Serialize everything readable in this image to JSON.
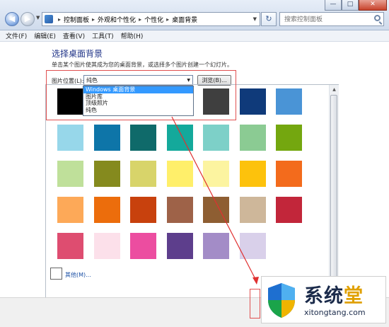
{
  "window": {
    "minimize": "—",
    "maximize": "□",
    "close": "✕"
  },
  "address_bar": {
    "breadcrumbs": [
      "控制面板",
      "外观和个性化",
      "个性化",
      "桌面背景"
    ],
    "search_placeholder": "搜索控制面板"
  },
  "menu": [
    "文件(F)",
    "编辑(E)",
    "查看(V)",
    "工具(T)",
    "帮助(H)"
  ],
  "page": {
    "title": "选择桌面背景",
    "subtitle": "单击某个图片使其成为您的桌面背景，或选择多个图片创建一个幻灯片。",
    "location_label": "图片位置(L):",
    "location_value": "纯色",
    "browse_button": "浏览(B)...",
    "location_options": [
      {
        "label": "Windows 桌面背景",
        "selected": true
      },
      {
        "label": "图片库",
        "selected": false
      },
      {
        "label": "顶级照片",
        "selected": false
      },
      {
        "label": "纯色",
        "selected": false
      }
    ],
    "other_link": "其他(M)..."
  },
  "swatches": [
    [
      "#000000",
      "#3a3a3a",
      "#ffffff",
      "#8a8a8a",
      "#3f3f3f",
      "#0f3a7a",
      "#4a94d6"
    ],
    [
      "#97d7ea",
      "#0e75a8",
      "#0f6a6a",
      "#14a99b",
      "#7dd0c8",
      "#8bcb93",
      "#74a70f"
    ],
    [
      "#bfe09a",
      "#858a1e",
      "#d8d46a",
      "#ffef6a",
      "#fcf4a0",
      "#fdc20c",
      "#f36b1c"
    ],
    [
      "#fda958",
      "#ec6d0c",
      "#c8410d",
      "#9e6248",
      "#8e5e32",
      "#ceb79a",
      "#c2263a"
    ],
    [
      "#de4d70",
      "#fce0ea",
      "#ec4da0",
      "#5d3e8c",
      "#a38cc7",
      "#d9d0ea",
      ""
    ]
  ],
  "watermark": {
    "cn": "系统",
    "cn_accent": "堂",
    "url": "xitongtang.com"
  }
}
